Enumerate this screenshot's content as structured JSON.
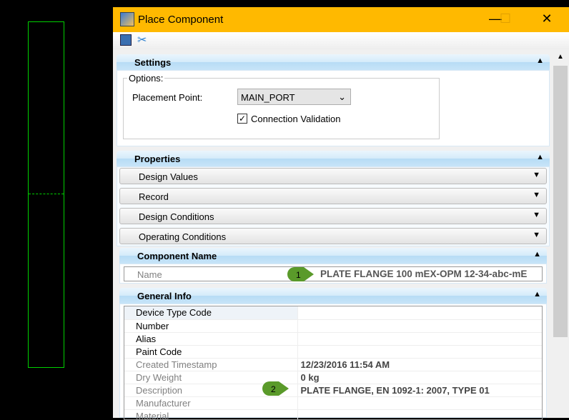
{
  "window": {
    "title": "Place Component",
    "minimize": "—",
    "maximize": "☐",
    "close": "✕"
  },
  "settings": {
    "header": "Settings",
    "options_label": "Options:",
    "placement_label": "Placement Point:",
    "placement_value": "MAIN_PORT",
    "connection_validation": "Connection Validation",
    "connection_checked": true
  },
  "properties": {
    "header": "Properties",
    "sections": [
      "Design Values",
      "Record",
      "Design Conditions",
      "Operating Conditions"
    ]
  },
  "component_name": {
    "header": "Component Name",
    "label": "Name",
    "value": "PLATE FLANGE 100 mEX-OPM 12-34-abc-mE",
    "callout": "1"
  },
  "general_info": {
    "header": "General Info",
    "rows": [
      {
        "label": "Device Type Code",
        "value": "",
        "editable": true
      },
      {
        "label": "Number",
        "value": "",
        "editable": true
      },
      {
        "label": "Alias",
        "value": "",
        "editable": true
      },
      {
        "label": "Paint Code",
        "value": "",
        "editable": true
      },
      {
        "label": "Created Timestamp",
        "value": "12/23/2016 11:54 AM",
        "editable": false
      },
      {
        "label": "Dry Weight",
        "value": "0 kg",
        "editable": false
      },
      {
        "label": "Description",
        "value": "PLATE FLANGE, EN 1092-1: 2007, TYPE 01",
        "editable": false
      },
      {
        "label": "Manufacturer",
        "value": "",
        "editable": false
      },
      {
        "label": "Material",
        "value": "",
        "editable": false
      }
    ],
    "callout": "2"
  }
}
